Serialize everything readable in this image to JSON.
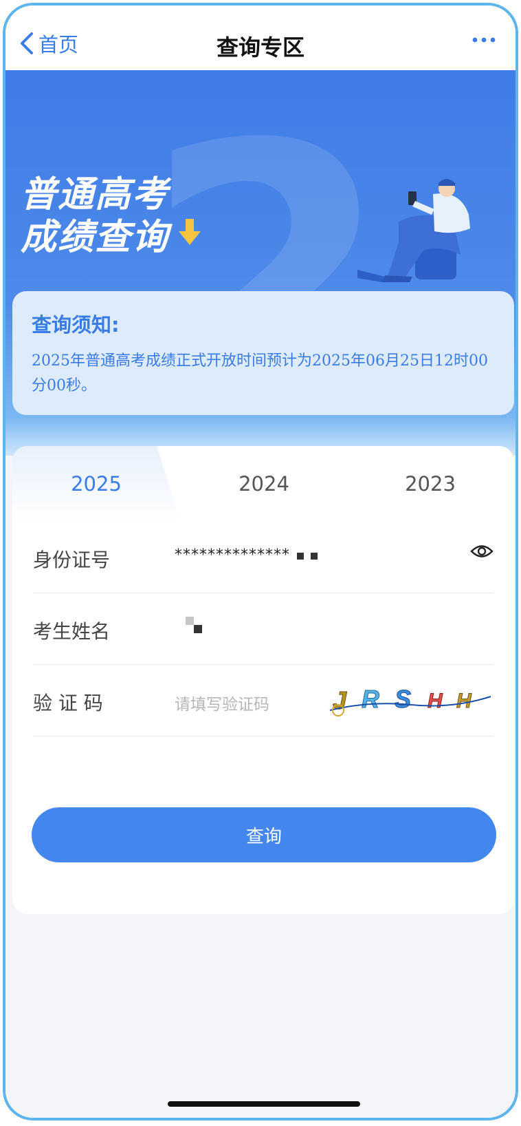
{
  "nav": {
    "back_label": "首页",
    "title": "查询专区"
  },
  "banner": {
    "line1": "普通高考",
    "line2": "成绩查询"
  },
  "notice": {
    "title": "查询须知:",
    "body": "2025年普通高考成绩正式开放时间预计为2025年06月25日12时00分00秒。"
  },
  "tabs": [
    {
      "label": "2025",
      "active": true
    },
    {
      "label": "2024",
      "active": false
    },
    {
      "label": "2023",
      "active": false
    }
  ],
  "form": {
    "id_label": "身份证号",
    "id_value": "**************",
    "name_label": "考生姓名",
    "captcha_label": "验 证 码",
    "captcha_placeholder": "请填写验证码",
    "captcha_text": "JRSHH"
  },
  "submit_label": "查询",
  "colors": {
    "accent": "#3a7ce6",
    "button": "#4387ee",
    "border": "#5db4ef"
  }
}
